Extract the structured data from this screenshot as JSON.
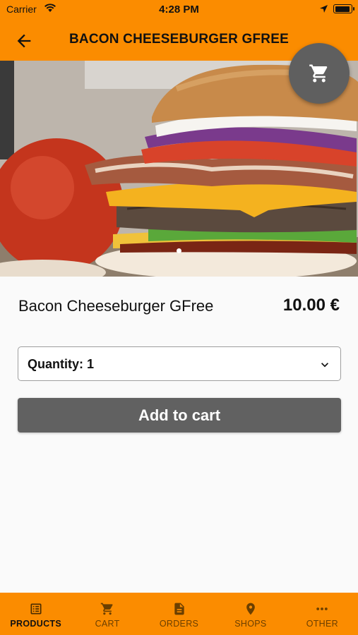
{
  "status_bar": {
    "carrier": "Carrier",
    "time": "4:28 PM"
  },
  "header": {
    "title": "BACON CHEESEBURGER GFREE",
    "back_icon": "arrow-left-icon"
  },
  "hero": {
    "image": "bacon cheeseburger photo",
    "slides": 1,
    "active_slide": 1
  },
  "cart_button": {
    "icon": "cart-icon"
  },
  "product": {
    "name": "Bacon Cheeseburger GFree",
    "price": "10.00 €"
  },
  "quantity": {
    "label": "Quantity: 1"
  },
  "add_to_cart": {
    "label": "Add to cart"
  },
  "bottom_nav": {
    "items": [
      {
        "label": "PRODUCTS",
        "icon": "list-icon",
        "active": true
      },
      {
        "label": "CART",
        "icon": "cart-icon",
        "active": false
      },
      {
        "label": "ORDERS",
        "icon": "document-icon",
        "active": false
      },
      {
        "label": "SHOPS",
        "icon": "location-pin-icon",
        "active": false
      },
      {
        "label": "OTHER",
        "icon": "more-dots-icon",
        "active": false
      }
    ]
  },
  "colors": {
    "primary": "#fb8c00",
    "button": "#616161",
    "background": "#fafafa"
  }
}
